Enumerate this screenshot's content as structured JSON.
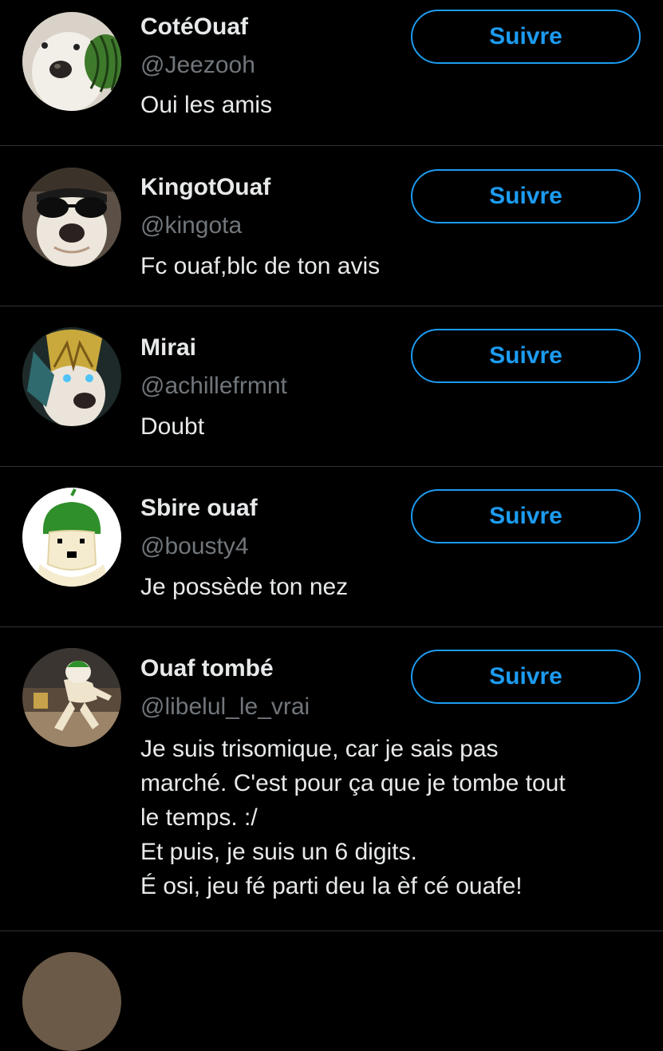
{
  "follow_label": "Suivre",
  "accent_color": "#1d9bf0",
  "users": [
    {
      "name": "CotéOuaf",
      "handle": "@Jeezooh",
      "bio_lines": [
        "Oui les amis"
      ],
      "avatar": "dog-with-watermelon-helmet"
    },
    {
      "name": "KingotOuaf",
      "handle": "@kingota",
      "bio_lines": [
        "Fc ouaf,blc de ton avis"
      ],
      "avatar": "dog-with-sunglasses"
    },
    {
      "name": "Mirai",
      "handle": "@achillefrmnt",
      "bio_lines": [
        "Doubt"
      ],
      "avatar": "dog-with-golden-armor"
    },
    {
      "name": "Sbire ouaf",
      "handle": "@bousty4",
      "bio_lines": [
        "Je possède ton nez"
      ],
      "avatar": "drawn-creature-green-hat"
    },
    {
      "name": "Ouaf tombé",
      "handle": "@libelul_le_vrai",
      "bio_lines": [
        "Je suis trisomique, car je sais pas",
        "marché. C'est pour ça que je tombe tout",
        "le temps. :/",
        "Et puis, je suis un 6 digits.",
        "É osi, jeu fé parti deu la èf cé ouafe!"
      ],
      "avatar": "fallen-dog-figure"
    }
  ]
}
